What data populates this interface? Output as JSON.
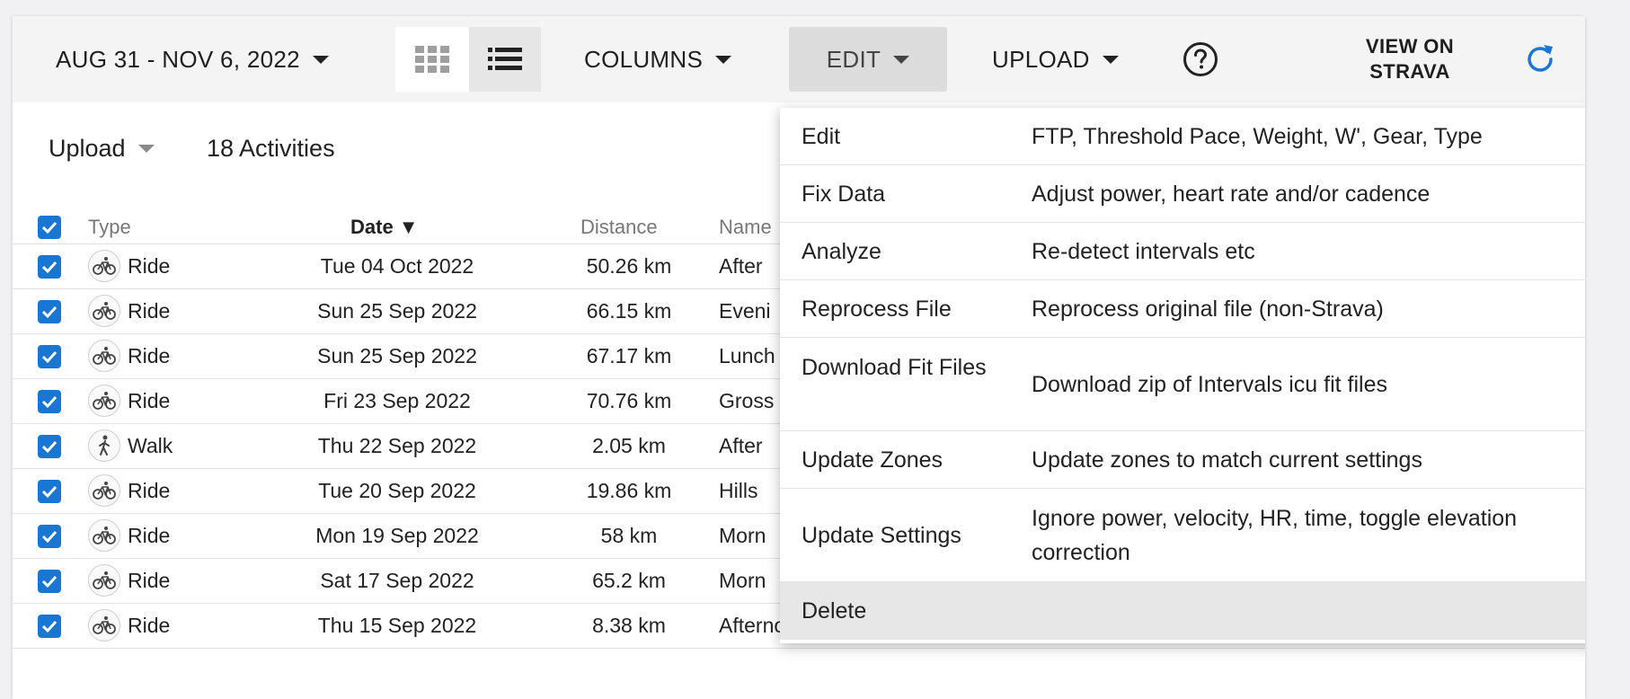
{
  "toolbar": {
    "date_range": "AUG 31 - NOV 6, 2022",
    "columns": "COLUMNS",
    "edit": "EDIT",
    "upload": "UPLOAD",
    "view_on_strava_line1": "VIEW ON",
    "view_on_strava_line2": "STRAVA",
    "icons": [
      "grid-view-icon",
      "list-view-icon",
      "help-icon",
      "refresh-icon"
    ],
    "accent": "#1976d2"
  },
  "subheader": {
    "upload": "Upload",
    "activities": "18 Activities"
  },
  "table": {
    "headers": {
      "type": "Type",
      "date": "Date ▼",
      "distance": "Distance",
      "name": "Name"
    },
    "rows": [
      {
        "type": "Ride",
        "date": "Tue 04 Oct 2022",
        "distance": "50.26 km",
        "name": "After"
      },
      {
        "type": "Ride",
        "date": "Sun 25 Sep 2022",
        "distance": "66.15 km",
        "name": "Eveni"
      },
      {
        "type": "Ride",
        "date": "Sun 25 Sep 2022",
        "distance": "67.17 km",
        "name": "Lunch"
      },
      {
        "type": "Ride",
        "date": "Fri 23 Sep 2022",
        "distance": "70.76 km",
        "name": "Gross"
      },
      {
        "type": "Walk",
        "date": "Thu 22 Sep 2022",
        "distance": "2.05 km",
        "name": "After"
      },
      {
        "type": "Ride",
        "date": "Tue 20 Sep 2022",
        "distance": "19.86 km",
        "name": "Hills"
      },
      {
        "type": "Ride",
        "date": "Mon 19 Sep 2022",
        "distance": "58 km",
        "name": "Morn"
      },
      {
        "type": "Ride",
        "date": "Sat 17 Sep 2022",
        "distance": "65.2 km",
        "name": "Morn"
      },
      {
        "type": "Ride",
        "date": "Thu 15 Sep 2022",
        "distance": "8.38 km",
        "name": "Afternoon Ride"
      }
    ]
  },
  "edit_menu": [
    {
      "label": "Edit",
      "desc": "FTP, Threshold Pace, Weight, W', Gear, Type"
    },
    {
      "label": "Fix Data",
      "desc": "Adjust power, heart rate and/or cadence"
    },
    {
      "label": "Analyze",
      "desc": "Re-detect intervals etc"
    },
    {
      "label": "Reprocess File",
      "desc": "Reprocess original file (non-Strava)"
    },
    {
      "label": "Download Fit Files",
      "desc": "Download zip of Intervals icu fit files"
    },
    {
      "label": "Update Zones",
      "desc": "Update zones to match current settings"
    },
    {
      "label": "Update Settings",
      "desc": "Ignore power, velocity, HR, time, toggle elevation correction"
    },
    {
      "label": "Delete",
      "desc": ""
    }
  ]
}
